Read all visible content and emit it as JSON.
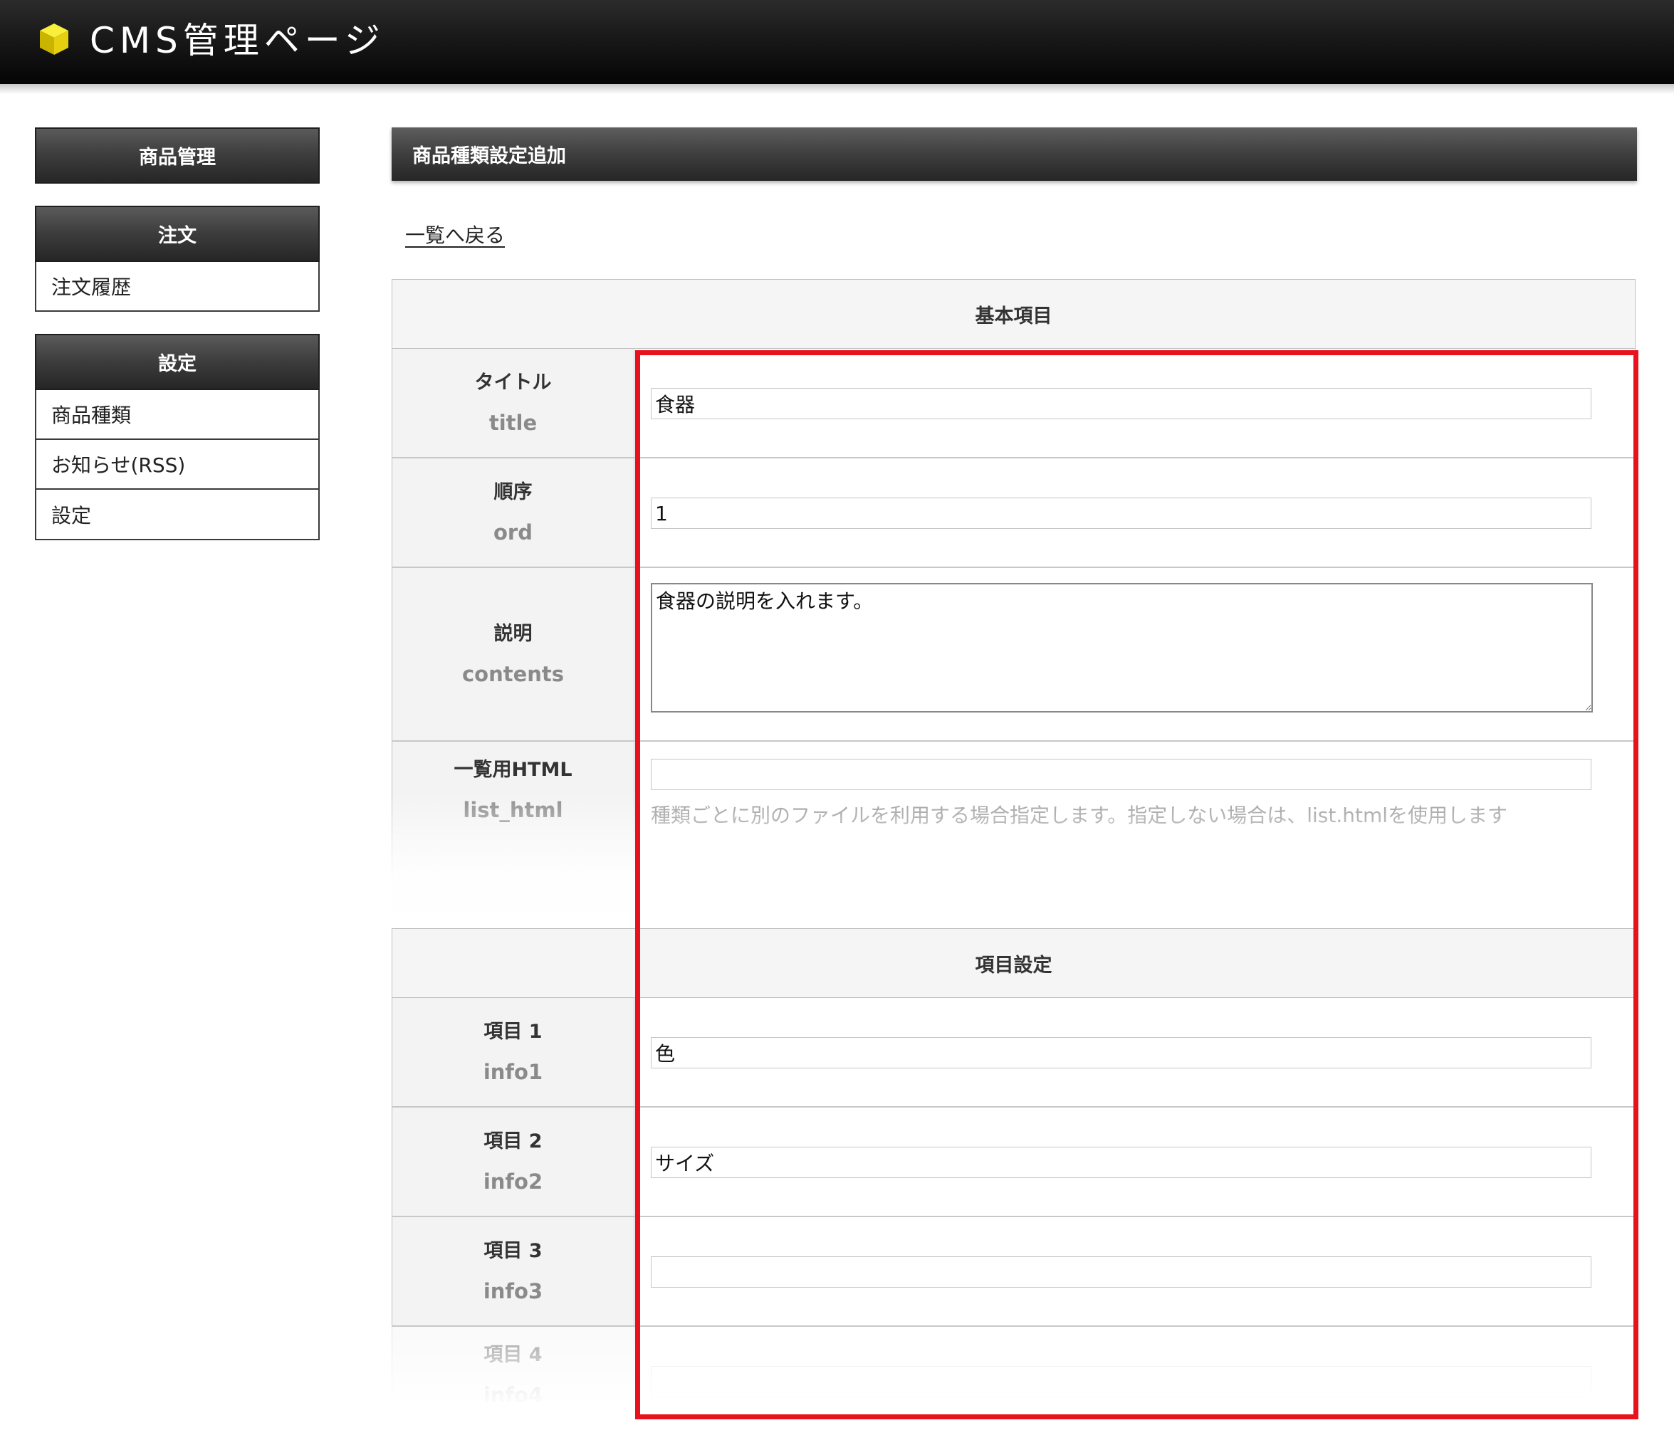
{
  "header": {
    "title": "CMS管理ページ",
    "logo_icon": "yellow-cube-icon"
  },
  "sidebar": {
    "sections": [
      {
        "label": "商品管理",
        "items": []
      },
      {
        "label": "注文",
        "items": [
          "注文履歴"
        ]
      },
      {
        "label": "設定",
        "items": [
          "商品種類",
          "お知らせ(RSS)",
          "設定"
        ]
      }
    ]
  },
  "main": {
    "title": "商品種類設定追加",
    "back_link": "一覧へ戻る",
    "section_basic": "基本項目",
    "section_items": "項目設定",
    "fields": {
      "title": {
        "label": "タイトル",
        "key": "title",
        "value": "食器"
      },
      "ord": {
        "label": "順序",
        "key": "ord",
        "value": "1"
      },
      "contents": {
        "label": "説明",
        "key": "contents",
        "value": "食器の説明を入れます。"
      },
      "list_html": {
        "label": "一覧用HTML",
        "key": "list_html",
        "value": "",
        "help": "種類ごとに別のファイルを利用する場合指定します。指定しない場合は、list.htmlを使用します"
      },
      "info1": {
        "label": "項目 1",
        "key": "info1",
        "value": "色"
      },
      "info2": {
        "label": "項目 2",
        "key": "info2",
        "value": "サイズ"
      },
      "info3": {
        "label": "項目 3",
        "key": "info3",
        "value": ""
      },
      "info4": {
        "label": "項目 4",
        "key": "info4",
        "value": ""
      }
    }
  },
  "colors": {
    "highlight": "#e8121c",
    "header_bg": "#151515",
    "label_bg": "#f3f3f3"
  }
}
